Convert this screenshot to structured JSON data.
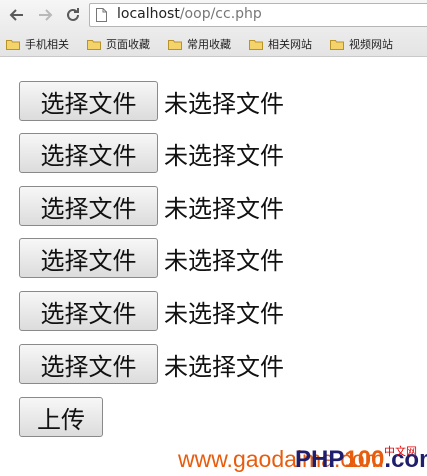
{
  "browser": {
    "url_host": "localhost",
    "url_path": "/oop/cc.php",
    "bookmarks": [
      "手机相关",
      "页面收藏",
      "常用收藏",
      "相关网站",
      "视频网站"
    ]
  },
  "form": {
    "file_inputs": [
      {
        "button_label": "选择文件",
        "status": "未选择文件"
      },
      {
        "button_label": "选择文件",
        "status": "未选择文件"
      },
      {
        "button_label": "选择文件",
        "status": "未选择文件"
      },
      {
        "button_label": "选择文件",
        "status": "未选择文件"
      },
      {
        "button_label": "选择文件",
        "status": "未选择文件"
      },
      {
        "button_label": "选择文件",
        "status": "未选择文件"
      }
    ],
    "submit_label": "上传"
  },
  "watermark": {
    "site": "www.gaodaima.com",
    "logo_prefix": "PHP",
    "logo_number": "100",
    "logo_suffix": ".com",
    "badge": "中文网"
  },
  "colors": {
    "watermark": "#e85c0d",
    "logo": "#1e1e6e"
  }
}
